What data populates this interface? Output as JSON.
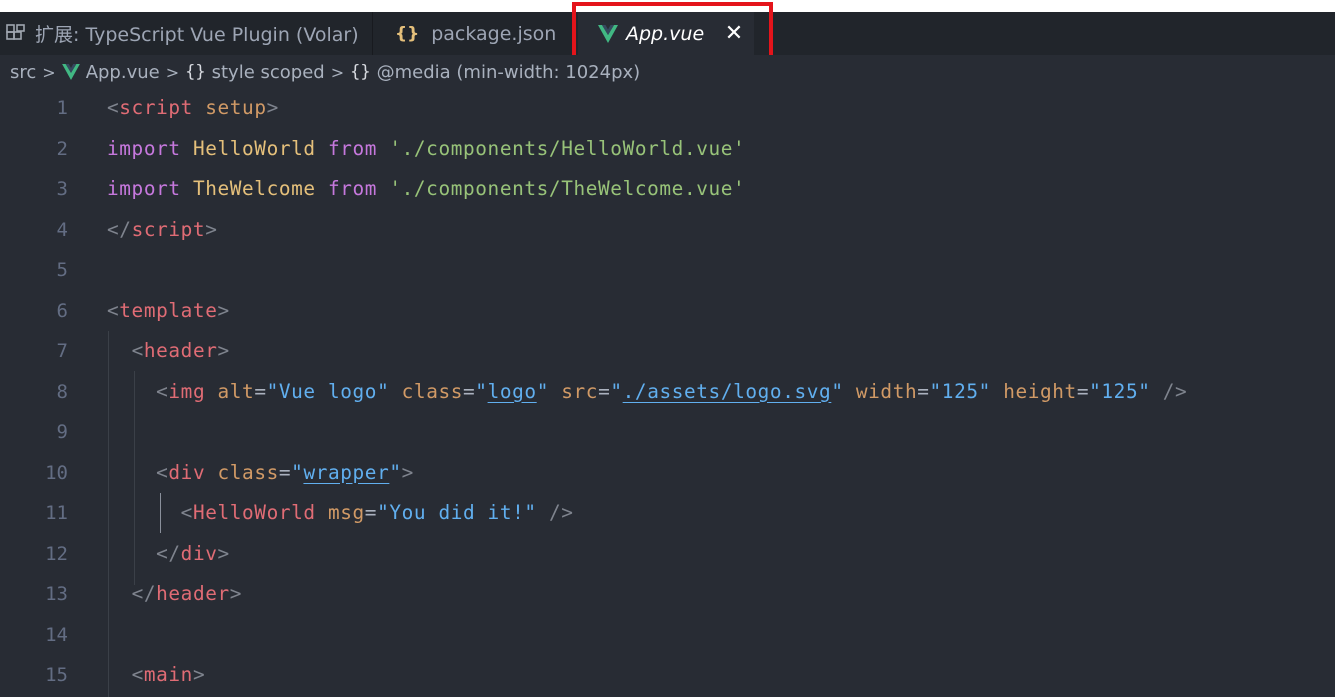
{
  "tabs": [
    {
      "icon": "extension-icon",
      "label": "扩展: TypeScript Vue Plugin (Volar)"
    },
    {
      "icon": "json-braces-icon",
      "glyph": "{}",
      "label": "package.json"
    },
    {
      "icon": "vue-icon",
      "label": "App.vue",
      "close_glyph": "✕",
      "active": true
    }
  ],
  "breadcrumb": {
    "items": [
      "src",
      "App.vue",
      "style scoped",
      "@media (min-width: 1024px)"
    ],
    "separator": ">",
    "braces": "{}"
  },
  "editor": {
    "lines": [
      {
        "n": "1",
        "tokens": [
          [
            "<",
            "tk-punc"
          ],
          [
            "script",
            "tk-tag"
          ],
          [
            " ",
            "tk-text"
          ],
          [
            "setup",
            "tk-attr"
          ],
          [
            ">",
            "tk-punc"
          ]
        ]
      },
      {
        "n": "2",
        "tokens": [
          [
            "import",
            "tk-kw"
          ],
          [
            " ",
            "tk-text"
          ],
          [
            "HelloWorld",
            "tk-id"
          ],
          [
            " ",
            "tk-text"
          ],
          [
            "from",
            "tk-kw"
          ],
          [
            " ",
            "tk-text"
          ],
          [
            "'./components/HelloWorld.vue'",
            "tk-str"
          ]
        ]
      },
      {
        "n": "3",
        "tokens": [
          [
            "import",
            "tk-kw"
          ],
          [
            " ",
            "tk-text"
          ],
          [
            "TheWelcome",
            "tk-id"
          ],
          [
            " ",
            "tk-text"
          ],
          [
            "from",
            "tk-kw"
          ],
          [
            " ",
            "tk-text"
          ],
          [
            "'./components/TheWelcome.vue'",
            "tk-str"
          ]
        ]
      },
      {
        "n": "4",
        "tokens": [
          [
            "</",
            "tk-punc"
          ],
          [
            "script",
            "tk-tag"
          ],
          [
            ">",
            "tk-punc"
          ]
        ]
      },
      {
        "n": "5",
        "tokens": []
      },
      {
        "n": "6",
        "tokens": [
          [
            "<",
            "tk-punc"
          ],
          [
            "template",
            "tk-tag"
          ],
          [
            ">",
            "tk-punc"
          ]
        ]
      },
      {
        "n": "7",
        "tokens": [
          [
            "  ",
            "tk-text"
          ],
          [
            "<",
            "tk-punc"
          ],
          [
            "header",
            "tk-tag"
          ],
          [
            ">",
            "tk-punc"
          ]
        ]
      },
      {
        "n": "8",
        "tokens": [
          [
            "    ",
            "tk-text"
          ],
          [
            "<",
            "tk-punc"
          ],
          [
            "img",
            "tk-tag"
          ],
          [
            " ",
            "tk-text"
          ],
          [
            "alt",
            "tk-attr"
          ],
          [
            "=",
            "tk-text"
          ],
          [
            "\"Vue logo\"",
            "tk-strv"
          ],
          [
            " ",
            "tk-text"
          ],
          [
            "class",
            "tk-attr"
          ],
          [
            "=",
            "tk-text"
          ],
          [
            "\"",
            "tk-strv"
          ],
          [
            "logo",
            "tk-strv u"
          ],
          [
            "\"",
            "tk-strv"
          ],
          [
            " ",
            "tk-text"
          ],
          [
            "src",
            "tk-attr"
          ],
          [
            "=",
            "tk-text"
          ],
          [
            "\"",
            "tk-strv"
          ],
          [
            "./assets/logo.svg",
            "tk-strv u"
          ],
          [
            "\"",
            "tk-strv"
          ],
          [
            " ",
            "tk-text"
          ],
          [
            "width",
            "tk-attr"
          ],
          [
            "=",
            "tk-text"
          ],
          [
            "\"125\"",
            "tk-strv"
          ],
          [
            " ",
            "tk-text"
          ],
          [
            "height",
            "tk-attr"
          ],
          [
            "=",
            "tk-text"
          ],
          [
            "\"125\"",
            "tk-strv"
          ],
          [
            " ",
            "tk-text"
          ],
          [
            "/>",
            "tk-punc"
          ]
        ]
      },
      {
        "n": "9",
        "tokens": []
      },
      {
        "n": "10",
        "tokens": [
          [
            "    ",
            "tk-text"
          ],
          [
            "<",
            "tk-punc"
          ],
          [
            "div",
            "tk-tag"
          ],
          [
            " ",
            "tk-text"
          ],
          [
            "class",
            "tk-attr"
          ],
          [
            "=",
            "tk-text"
          ],
          [
            "\"",
            "tk-strv"
          ],
          [
            "wrapper",
            "tk-strv u"
          ],
          [
            "\"",
            "tk-strv"
          ],
          [
            ">",
            "tk-punc"
          ]
        ]
      },
      {
        "n": "11",
        "tokens": [
          [
            "      ",
            "tk-text"
          ],
          [
            "<",
            "tk-punc"
          ],
          [
            "HelloWorld",
            "tk-tag"
          ],
          [
            " ",
            "tk-text"
          ],
          [
            "msg",
            "tk-attr"
          ],
          [
            "=",
            "tk-text"
          ],
          [
            "\"You did it!\"",
            "tk-strv"
          ],
          [
            " ",
            "tk-text"
          ],
          [
            "/>",
            "tk-punc"
          ]
        ]
      },
      {
        "n": "12",
        "tokens": [
          [
            "    ",
            "tk-text"
          ],
          [
            "</",
            "tk-punc"
          ],
          [
            "div",
            "tk-tag"
          ],
          [
            ">",
            "tk-punc"
          ]
        ]
      },
      {
        "n": "13",
        "tokens": [
          [
            "  ",
            "tk-text"
          ],
          [
            "</",
            "tk-punc"
          ],
          [
            "header",
            "tk-tag"
          ],
          [
            ">",
            "tk-punc"
          ]
        ]
      },
      {
        "n": "14",
        "tokens": []
      },
      {
        "n": "15",
        "tokens": [
          [
            "  ",
            "tk-text"
          ],
          [
            "<",
            "tk-punc"
          ],
          [
            "main",
            "tk-tag"
          ],
          [
            ">",
            "tk-punc"
          ]
        ]
      }
    ]
  },
  "colors": {
    "editor_bg": "#282c34",
    "tabbar_bg": "#21252b",
    "highlight_border": "#e4141b",
    "vue_green": "#41b883"
  }
}
